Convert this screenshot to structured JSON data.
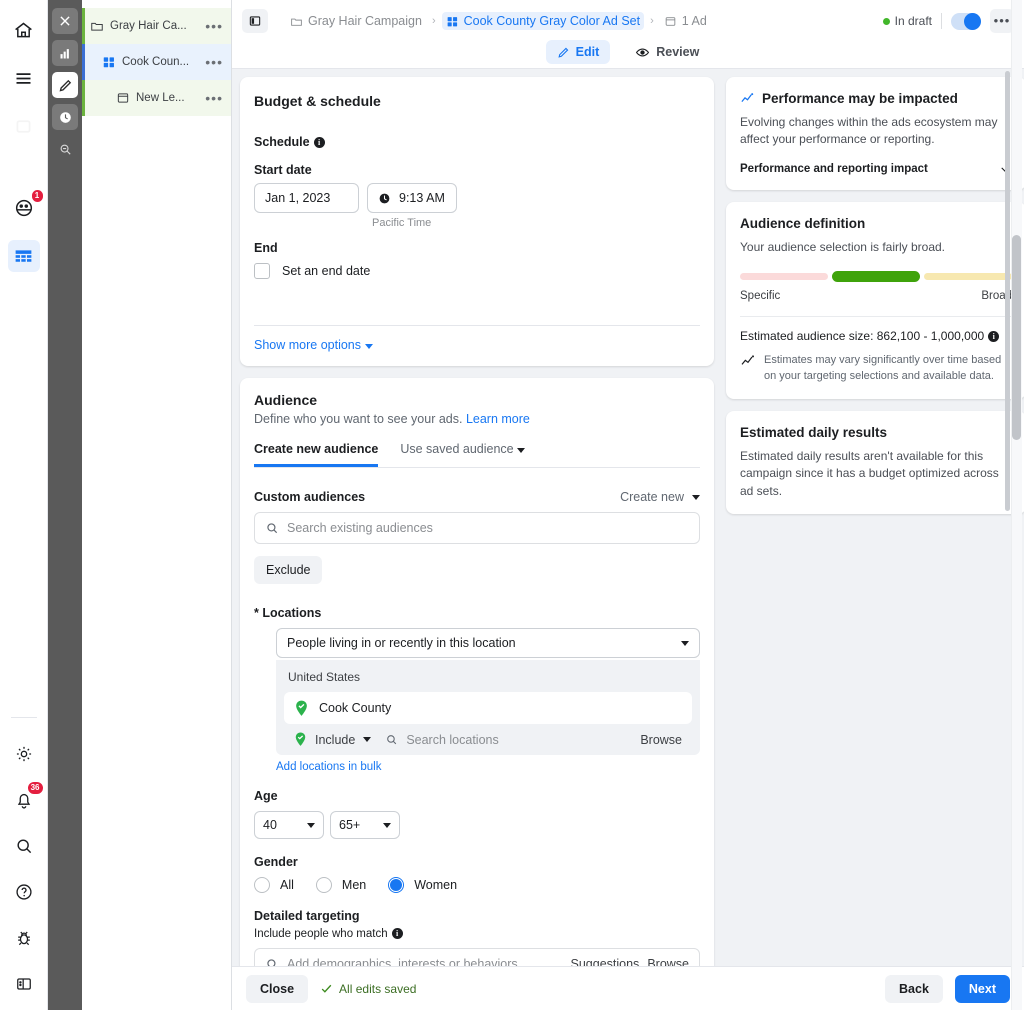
{
  "rail": {
    "items": [
      {
        "name": "home-icon",
        "label": "Home"
      },
      {
        "name": "menu-icon",
        "label": "All tools"
      },
      {
        "name": "placeholder-icon",
        "label": ""
      },
      {
        "name": "notifications-icon",
        "label": "Notifications",
        "badge": "1"
      },
      {
        "name": "table-icon",
        "label": "Campaigns"
      }
    ],
    "bottom": [
      {
        "name": "gear-icon",
        "label": "Settings"
      },
      {
        "name": "bell-icon",
        "label": "Alerts",
        "badge": "36"
      },
      {
        "name": "search-icon",
        "label": "Search"
      },
      {
        "name": "help-icon",
        "label": "Help"
      },
      {
        "name": "bug-icon",
        "label": "Report a bug"
      },
      {
        "name": "panel-icon",
        "label": "Toggle panel"
      }
    ]
  },
  "toolrail": {
    "items": [
      {
        "name": "close-icon",
        "label": "Close"
      },
      {
        "name": "chart-icon",
        "label": "Charts"
      },
      {
        "name": "edit-icon",
        "label": "Edit",
        "active": true
      },
      {
        "name": "history-icon",
        "label": "History"
      },
      {
        "name": "inspect-icon",
        "label": "Inspect"
      }
    ]
  },
  "tree": {
    "items": [
      {
        "label": "Gray Hair Ca...",
        "icon": "folder-icon",
        "more": "•••",
        "level": "campaign"
      },
      {
        "label": "Cook Coun...",
        "icon": "adset-icon",
        "more": "•••",
        "level": "adset"
      },
      {
        "label": "New Le...",
        "icon": "ad-icon",
        "more": "•••",
        "level": "ad"
      }
    ]
  },
  "topbar": {
    "panel_toggle": "panel-toggle-icon",
    "breadcrumbs": [
      {
        "label": "Gray Hair Campaign",
        "icon": "folder-icon",
        "active": false
      },
      {
        "label": "Cook County Gray Color Ad Set",
        "icon": "adset-icon",
        "active": true
      },
      {
        "label": "1 Ad",
        "icon": "ad-icon",
        "active": false
      }
    ],
    "separator": "›",
    "status": "In draft",
    "more": "•••",
    "tabs": [
      {
        "label": "Edit",
        "icon": "pencil-icon",
        "active": true
      },
      {
        "label": "Review",
        "icon": "eye-icon",
        "active": false
      }
    ]
  },
  "budget": {
    "title": "Budget & schedule",
    "schedule_label": "Schedule",
    "start_date_label": "Start date",
    "start_date_value": "Jan 1, 2023",
    "start_time_value": "9:13 AM",
    "timezone": "Pacific Time",
    "end_label": "End",
    "end_checkbox_label": "Set an end date",
    "show_more": "Show more options"
  },
  "audience": {
    "title": "Audience",
    "subtitle": "Define who you want to see your ads.",
    "learn_more": "Learn more",
    "tabs": [
      {
        "label": "Create new audience",
        "active": true
      },
      {
        "label": "Use saved audience",
        "active": false
      }
    ],
    "custom_audiences_label": "Custom audiences",
    "create_new": "Create new",
    "search_placeholder": "Search existing audiences",
    "exclude_button": "Exclude",
    "locations_label": "* Locations",
    "location_mode": "People living in or recently in this location",
    "country": "United States",
    "location_items": [
      {
        "label": "Cook County",
        "icon": "location-pin-check-icon"
      }
    ],
    "include_label": "Include",
    "search_locations_placeholder": "Search locations",
    "browse": "Browse",
    "add_bulk": "Add locations in bulk",
    "age_label": "Age",
    "age_min": "40",
    "age_max": "65+",
    "gender_label": "Gender",
    "genders": [
      {
        "label": "All",
        "selected": false
      },
      {
        "label": "Men",
        "selected": false
      },
      {
        "label": "Women",
        "selected": true
      }
    ],
    "detailed_label": "Detailed targeting",
    "include_match_label": "Include people who match",
    "detailed_placeholder": "Add demographics, interests or behaviors",
    "suggestions": "Suggestions",
    "detailed_browse": "Browse"
  },
  "right": {
    "performance": {
      "title": "Performance may be impacted",
      "body": "Evolving changes within the ads ecosystem may affect your performance or reporting.",
      "collapse_label": "Performance and reporting impact"
    },
    "audience_definition": {
      "title": "Audience definition",
      "body": "Your audience selection is fairly broad.",
      "scale_left": "Specific",
      "scale_right": "Broad",
      "estimate_label": "Estimated audience size:",
      "estimate_value": "862,100 - 1,000,000",
      "note": "Estimates may vary significantly over time based on your targeting selections and available data."
    },
    "daily_results": {
      "title": "Estimated daily results",
      "body": "Estimated daily results aren't available for this campaign since it has a budget optimized across ad sets."
    }
  },
  "bottombar": {
    "close": "Close",
    "saved": "All edits saved",
    "back": "Back",
    "next": "Next"
  },
  "colors": {
    "accent": "#1877f2",
    "green": "#42b72a",
    "meter_green": "#3fa30b",
    "meter_pink": "#fbdada",
    "meter_yellow": "#f7e8b0",
    "badge_red": "#e41e3f"
  }
}
